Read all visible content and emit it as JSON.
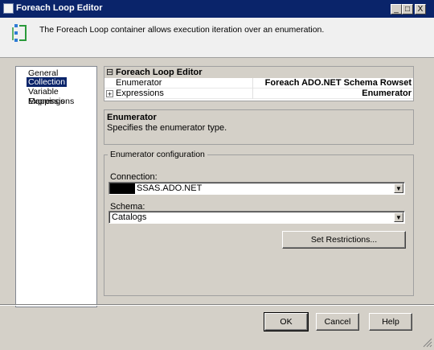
{
  "window": {
    "title": "Foreach Loop Editor",
    "controls": {
      "minimize": "_",
      "maximize": "□",
      "close": "X"
    }
  },
  "banner": {
    "description": "The Foreach Loop container allows execution iteration over an enumeration."
  },
  "nav": {
    "items": [
      {
        "label": "General",
        "selected": false
      },
      {
        "label": "Collection",
        "selected": true
      },
      {
        "label": "Variable Mappings",
        "selected": false
      },
      {
        "label": "Expressions",
        "selected": false
      }
    ]
  },
  "property_grid": {
    "category": "Foreach Loop Editor",
    "category_toggle": "⊟",
    "rows": [
      {
        "name": "Enumerator",
        "value": "Foreach ADO.NET Schema Rowset Enumerator"
      },
      {
        "name": "Expressions",
        "value": "",
        "expand": "+"
      }
    ]
  },
  "description_panel": {
    "title": "Enumerator",
    "text": "Specifies the enumerator type."
  },
  "enumerator_config": {
    "legend": "Enumerator configuration",
    "connection_label": "Connection:",
    "connection_value": "SSAS.ADO.NET",
    "schema_label": "Schema:",
    "schema_value": "Catalogs",
    "set_restrictions_label": "Set Restrictions..."
  },
  "footer": {
    "ok": "OK",
    "cancel": "Cancel",
    "help": "Help"
  },
  "colors": {
    "titlebar": "#0a246a",
    "selection": "#0a246a",
    "dialog_bg": "#d4d0c8"
  }
}
